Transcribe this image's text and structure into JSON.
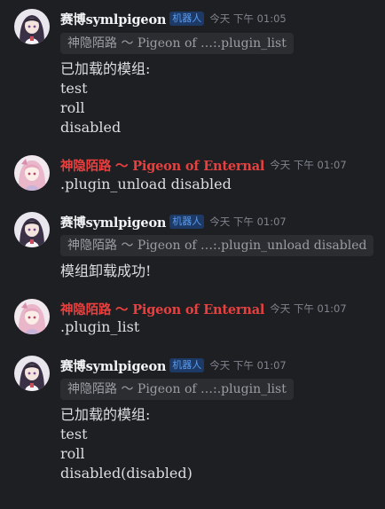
{
  "messages": [
    {
      "author": "赛博symlpigeon",
      "badge": "机器人",
      "time": "今天 下午 01:05",
      "reply": "神隐陌路 ～ Pigeon of …:.plugin_list",
      "lines": [
        "已加载的模组:",
        "test",
        "roll",
        "disabled"
      ]
    },
    {
      "author": "神隐陌路 ～ Pigeon of Enternal",
      "time": "今天 下午 01:07",
      "lines": [
        ".plugin_unload disabled"
      ]
    },
    {
      "author": "赛博symlpigeon",
      "badge": "机器人",
      "time": "今天 下午 01:07",
      "reply": "神隐陌路 ～ Pigeon of …:.plugin_unload disabled",
      "lines": [
        "模组卸载成功!"
      ]
    },
    {
      "author": "神隐陌路 ～ Pigeon of Enternal",
      "time": "今天 下午 01:07",
      "lines": [
        ".plugin_list"
      ]
    },
    {
      "author": "赛博symlpigeon",
      "badge": "机器人",
      "time": "今天 下午 01:07",
      "reply": "神隐陌路 ～ Pigeon of …:.plugin_list",
      "lines": [
        "已加载的模组:",
        "test",
        "roll",
        "disabled(disabled)"
      ]
    }
  ],
  "colors": {
    "background": "#1e1f22",
    "bot_name": "#f2f3f5",
    "user_name": "#e8403f",
    "badge_bg": "#1d3a67",
    "badge_text": "#5b9cf0",
    "timestamp": "#80848e",
    "reply_bg": "#2b2d31"
  }
}
